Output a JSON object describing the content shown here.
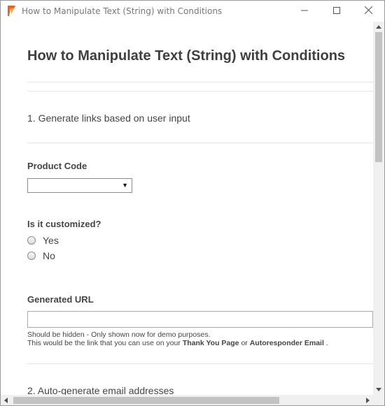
{
  "window": {
    "title": "How to Manipulate Text (String) with Conditions",
    "minimize_icon": "minimize-icon",
    "maximize_icon": "maximize-icon",
    "close_icon": "close-icon",
    "app_icon": "app-logo-icon"
  },
  "page": {
    "title": "How to Manipulate Text (String) with Conditions",
    "section1": "1. Generate links based on user input",
    "section2": "2. Auto-generate email addresses"
  },
  "form": {
    "product_code": {
      "label": "Product Code",
      "value": ""
    },
    "customized": {
      "label": "Is it customized?",
      "options": [
        "Yes",
        "No"
      ],
      "selected": null
    },
    "generated_url": {
      "label": "Generated URL",
      "value": "",
      "help_line1": "Should be hidden - Only shown now for demo purposes.",
      "help_line2_prefix": "This would be the link that you can use on your ",
      "help_line2_bold1": "Thank You Page",
      "help_line2_mid": " or ",
      "help_line2_bold2": "Autoresponder Email",
      "help_line2_suffix": " ."
    }
  },
  "colors": {
    "app_icon": "#e8661e",
    "title_text": "#777777",
    "heading": "#3f3f3f",
    "scroll_track": "#f0f0f0",
    "scroll_thumb": "#c2c2c2"
  }
}
